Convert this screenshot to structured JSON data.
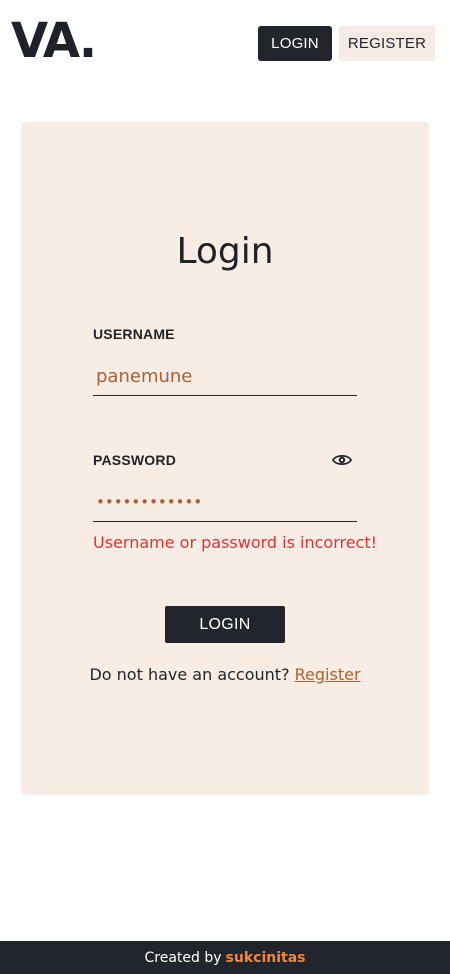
{
  "header": {
    "logo": "VA.",
    "login_label": "LOGIN",
    "register_label": "REGISTER"
  },
  "form": {
    "title": "Login",
    "username_label": "USERNAME",
    "username_value": "panemune",
    "password_label": "PASSWORD",
    "password_value": "••••••••••••",
    "error": "Username or password is incorrect!",
    "submit_label": "LOGIN",
    "no_account_text": "Do not have an account?",
    "register_link": "Register"
  },
  "footer": {
    "prefix": "Created by",
    "author": "sukcinitas"
  },
  "colors": {
    "dark": "#22262c",
    "card_bg": "#f8ede4",
    "accent": "#b06030",
    "error": "#e53333",
    "footer_author": "#f2873a"
  },
  "icons": {
    "password_toggle": "eye-icon"
  }
}
